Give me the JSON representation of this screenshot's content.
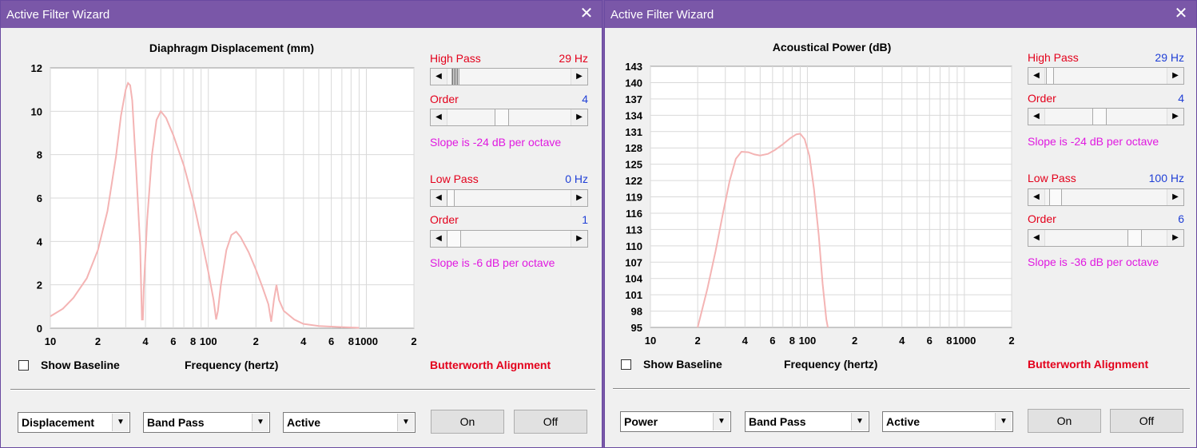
{
  "windows": [
    {
      "title": "Active Filter Wizard",
      "close_glyph": "✕",
      "chart_data": {
        "type": "line",
        "title": "Diaphragm Displacement (mm)",
        "xlabel": "Frequency (hertz)",
        "xscale": "log",
        "xlim": [
          10,
          2000
        ],
        "ylim": [
          0,
          12
        ],
        "yticks": [
          "0",
          "2",
          "4",
          "6",
          "8",
          "10",
          "12"
        ],
        "xticks": [
          {
            "v": 10,
            "t": "10"
          },
          {
            "v": 20,
            "t": "2"
          },
          {
            "v": 40,
            "t": "4"
          },
          {
            "v": 60,
            "t": "6"
          },
          {
            "v": 80,
            "t": "8"
          },
          {
            "v": 100,
            "t": "100"
          },
          {
            "v": 200,
            "t": "2"
          },
          {
            "v": 400,
            "t": "4"
          },
          {
            "v": 600,
            "t": "6"
          },
          {
            "v": 800,
            "t": "8"
          },
          {
            "v": 1000,
            "t": "1000"
          },
          {
            "v": 2000,
            "t": "2"
          }
        ],
        "grid": true,
        "line_color": "#f4b4b4",
        "series": [
          {
            "points": [
              [
                10,
                0.55
              ],
              [
                12,
                0.9
              ],
              [
                14,
                1.4
              ],
              [
                17,
                2.3
              ],
              [
                20,
                3.6
              ],
              [
                23,
                5.4
              ],
              [
                26,
                7.9
              ],
              [
                28,
                9.8
              ],
              [
                30,
                11.0
              ],
              [
                31,
                11.3
              ],
              [
                32,
                11.2
              ],
              [
                33,
                10.5
              ],
              [
                35,
                7.2
              ],
              [
                37,
                3.8
              ],
              [
                38,
                0.4
              ],
              [
                38.5,
                0.4
              ],
              [
                39,
                1.8
              ],
              [
                41,
                5.0
              ],
              [
                44,
                8.0
              ],
              [
                47,
                9.6
              ],
              [
                50,
                10.0
              ],
              [
                54,
                9.7
              ],
              [
                60,
                8.9
              ],
              [
                70,
                7.5
              ],
              [
                80,
                5.9
              ],
              [
                90,
                4.2
              ],
              [
                100,
                2.6
              ],
              [
                108,
                1.3
              ],
              [
                112,
                0.4
              ],
              [
                115,
                0.8
              ],
              [
                120,
                2.0
              ],
              [
                130,
                3.6
              ],
              [
                140,
                4.3
              ],
              [
                150,
                4.45
              ],
              [
                160,
                4.2
              ],
              [
                180,
                3.5
              ],
              [
                200,
                2.7
              ],
              [
                220,
                1.9
              ],
              [
                240,
                1.1
              ],
              [
                250,
                0.3
              ],
              [
                260,
                1.3
              ],
              [
                270,
                2.0
              ],
              [
                280,
                1.3
              ],
              [
                300,
                0.8
              ],
              [
                350,
                0.4
              ],
              [
                400,
                0.2
              ],
              [
                500,
                0.1
              ],
              [
                700,
                0.05
              ],
              [
                900,
                0.02
              ]
            ]
          }
        ]
      },
      "highpass": {
        "label": "High Pass",
        "value": "29 Hz",
        "order_label": "Order",
        "order_value": "4",
        "slope_text": "Slope is -24 dB per octave"
      },
      "lowpass": {
        "label": "Low Pass",
        "value": "0 Hz",
        "order_label": "Order",
        "order_value": "1",
        "slope_text": "Slope is -6 dB per octave"
      },
      "controls": {
        "show_baseline": "Show Baseline",
        "alignment": "Butterworth Alignment",
        "combo_view": "Displacement",
        "combo_filter": "Band Pass",
        "combo_mode": "Active",
        "on_label": "On",
        "off_label": "Off"
      }
    },
    {
      "title": "Active Filter Wizard",
      "close_glyph": "✕",
      "chart_data": {
        "type": "line",
        "title": "Acoustical Power (dB)",
        "xlabel": "Frequency (hertz)",
        "xscale": "log",
        "xlim": [
          10,
          2000
        ],
        "ylim": [
          95,
          143
        ],
        "yticks": [
          "95",
          "98",
          "101",
          "104",
          "107",
          "110",
          "113",
          "116",
          "119",
          "122",
          "125",
          "128",
          "131",
          "134",
          "137",
          "140",
          "143"
        ],
        "xticks": [
          {
            "v": 10,
            "t": "10"
          },
          {
            "v": 20,
            "t": "2"
          },
          {
            "v": 40,
            "t": "4"
          },
          {
            "v": 60,
            "t": "6"
          },
          {
            "v": 80,
            "t": "8"
          },
          {
            "v": 100,
            "t": "100"
          },
          {
            "v": 200,
            "t": "2"
          },
          {
            "v": 400,
            "t": "4"
          },
          {
            "v": 600,
            "t": "6"
          },
          {
            "v": 800,
            "t": "8"
          },
          {
            "v": 1000,
            "t": "1000"
          },
          {
            "v": 2000,
            "t": "2"
          }
        ],
        "grid": true,
        "line_color": "#f4b4b4",
        "series": [
          {
            "points": [
              [
                20,
                95
              ],
              [
                23,
                102
              ],
              [
                26,
                109
              ],
              [
                29,
                116
              ],
              [
                32,
                122
              ],
              [
                35,
                126
              ],
              [
                38,
                127.3
              ],
              [
                42,
                127.2
              ],
              [
                46,
                126.8
              ],
              [
                50,
                126.6
              ],
              [
                56,
                126.9
              ],
              [
                62,
                127.6
              ],
              [
                70,
                128.7
              ],
              [
                78,
                129.8
              ],
              [
                85,
                130.5
              ],
              [
                90,
                130.6
              ],
              [
                96,
                129.6
              ],
              [
                103,
                126.5
              ],
              [
                110,
                120.5
              ],
              [
                118,
                112
              ],
              [
                125,
                103
              ],
              [
                132,
                96.5
              ],
              [
                135,
                95
              ]
            ]
          }
        ]
      },
      "highpass": {
        "label": "High Pass",
        "value": "29 Hz",
        "order_label": "Order",
        "order_value": "4",
        "slope_text": "Slope is -24 dB per octave"
      },
      "lowpass": {
        "label": "Low Pass",
        "value": "100 Hz",
        "order_label": "Order",
        "order_value": "6",
        "slope_text": "Slope is -36 dB per octave"
      },
      "controls": {
        "show_baseline": "Show Baseline",
        "alignment": "Butterworth Alignment",
        "combo_view": "Power",
        "combo_filter": "Band Pass",
        "combo_mode": "Active",
        "on_label": "On",
        "off_label": "Off"
      }
    }
  ],
  "icons": {
    "arrow_left": "◀",
    "arrow_right": "▶",
    "dropdown": "▼"
  }
}
